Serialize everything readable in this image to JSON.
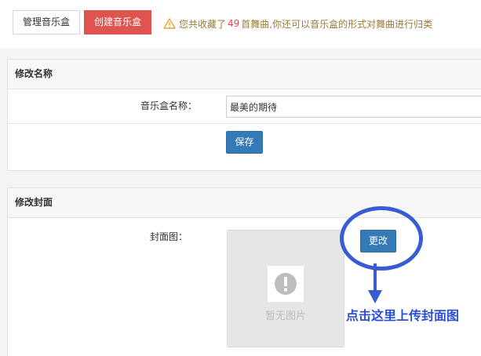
{
  "toolbar": {
    "manage_label": "管理音乐盒",
    "create_label": "创建音乐盒"
  },
  "notice": {
    "icon": "warning-triangle-icon",
    "prefix": "您共收藏了",
    "count": "49",
    "suffix": "首舞曲,你还可以音乐盒的形式对舞曲进行归类"
  },
  "rename_panel": {
    "title": "修改名称",
    "name_label": "音乐盒名称：",
    "name_value": "最美的期待",
    "save_label": "保存"
  },
  "cover_panel": {
    "title": "修改封面",
    "cover_label": "封面图：",
    "placeholder_text": "暂无图片",
    "placeholder_icon": "exclamation-circle-icon",
    "change_label": "更改"
  },
  "annotation": {
    "text": "点击这里上传封面图",
    "color": "#3a5bd1"
  },
  "colors": {
    "primary": "#337ab7",
    "danger": "#e0534f",
    "count": "#e24b3c"
  }
}
